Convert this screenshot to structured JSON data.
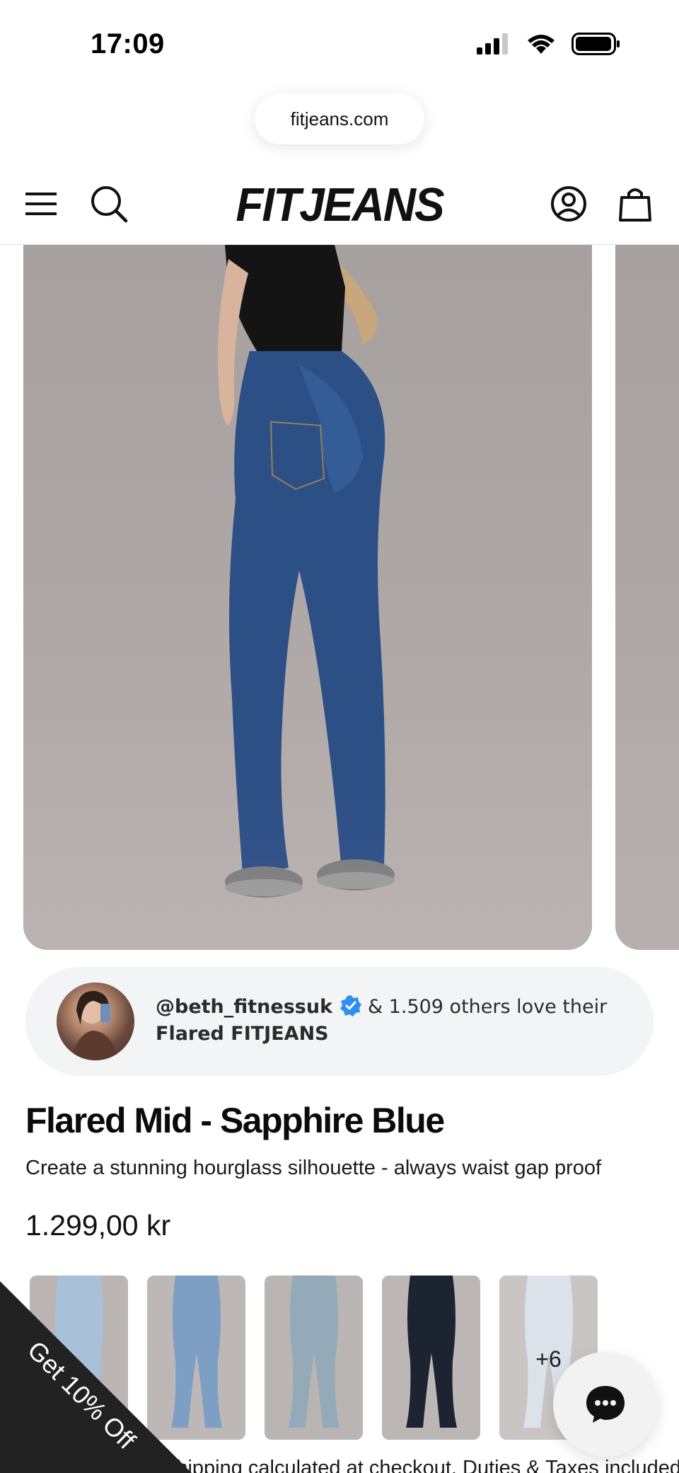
{
  "status_bar": {
    "time": "17:09",
    "icons": [
      "signal-icon",
      "wifi-icon",
      "battery-icon"
    ]
  },
  "browser": {
    "url": "fitjeans.com"
  },
  "header": {
    "logo": "FITJEANS",
    "icons": [
      "menu-icon",
      "search-icon",
      "account-icon",
      "bag-icon"
    ]
  },
  "social_proof": {
    "handle": "@beth_fitnessuk",
    "text": "& 1.509 others love their",
    "product": "Flared FITJEANS"
  },
  "product": {
    "title": "Flared Mid - Sapphire Blue",
    "subtitle": "Create a stunning hourglass silhouette - always waist gap proof",
    "price": "1.299,00 kr"
  },
  "variants": {
    "swatches": [
      {
        "color": "#9fb7d2"
      },
      {
        "color": "#6f91b8"
      },
      {
        "color": "#8fa6b6"
      },
      {
        "color": "#1c2330"
      },
      {
        "color": "#d3dbe4"
      }
    ],
    "more_label": "+6"
  },
  "checkout_note": "Shipping calculated at checkout. Duties & Taxes included",
  "discount_tab": "Get 10% Off",
  "colors": {
    "accent_dark": "#222222",
    "verified_blue": "#2f8ff0",
    "card_bg": "#f3f4f6"
  }
}
